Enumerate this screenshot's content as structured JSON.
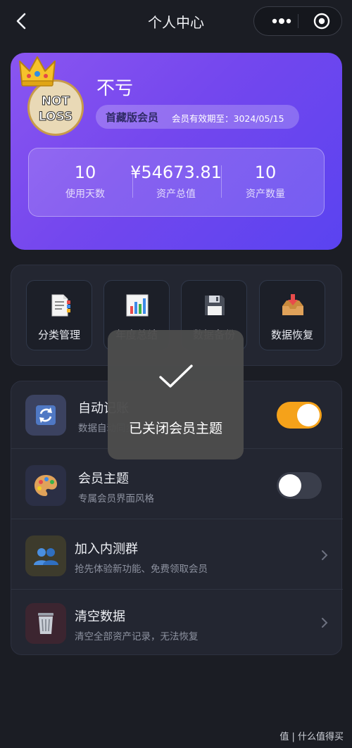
{
  "nav": {
    "title": "个人中心"
  },
  "profile": {
    "avatar_line1": "NOT",
    "avatar_line2": "LOSS",
    "name": "不亏",
    "member_level": "首藏版会员",
    "expiry": "会员有效期至：3024/05/15",
    "stats": [
      {
        "value": "10",
        "label": "使用天数"
      },
      {
        "value": "¥54673.81",
        "label": "资产总值"
      },
      {
        "value": "10",
        "label": "资产数量"
      }
    ]
  },
  "features": [
    {
      "label": "分类管理",
      "icon": "document-icon"
    },
    {
      "label": "年度总结",
      "icon": "bar-chart-icon"
    },
    {
      "label": "数据备份",
      "icon": "floppy-disk-icon"
    },
    {
      "label": "数据恢复",
      "icon": "inbox-tray-icon"
    }
  ],
  "settings": [
    {
      "title": "自动记账",
      "subtitle": "数据自动同步",
      "icon": "sync-arrows-icon",
      "control": "toggle",
      "on": true
    },
    {
      "title": "会员主题",
      "subtitle": "专属会员界面风格",
      "icon": "palette-icon",
      "control": "toggle",
      "on": false
    },
    {
      "title": "加入内测群",
      "subtitle": "抢先体验新功能、免费领取会员",
      "icon": "people-icon",
      "control": "chevron"
    },
    {
      "title": "清空数据",
      "subtitle": "清空全部资产记录，无法恢复",
      "icon": "trash-bin-icon",
      "control": "chevron"
    }
  ],
  "toast": {
    "message": "已关闭会员主题"
  },
  "watermark": "值 | 什么值得买",
  "colors": {
    "accent": "#f5a21a",
    "card_gradient_start": "#8a55f0",
    "card_gradient_end": "#5a43f0"
  }
}
